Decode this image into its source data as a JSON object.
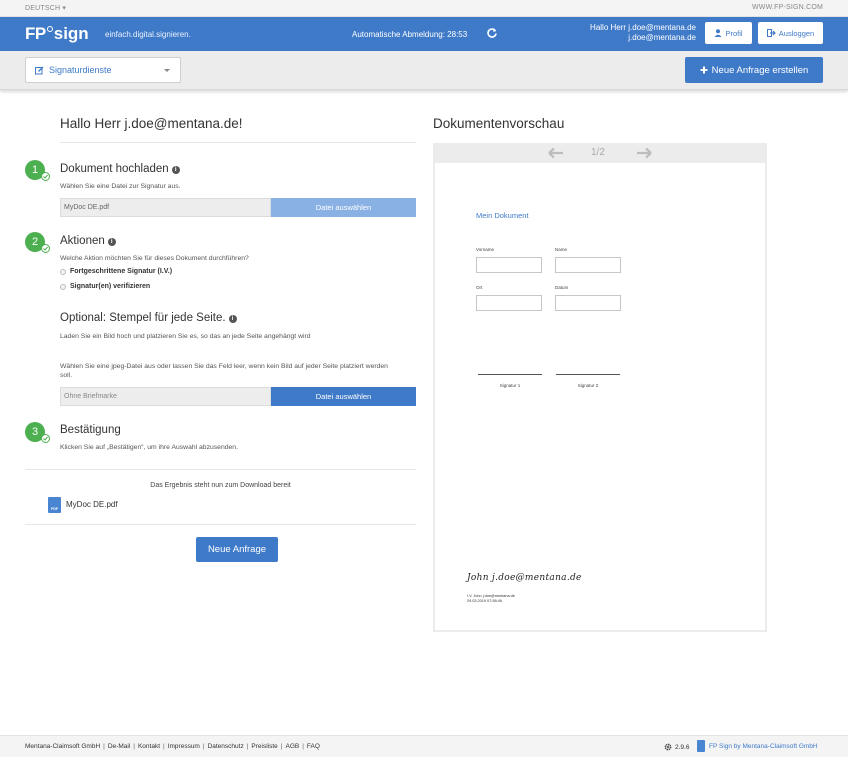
{
  "topbar": {
    "language": "DEUTSCH",
    "site": "WWW.FP-SIGN.COM"
  },
  "header": {
    "logo_fp": "FP",
    "logo_sign": "sign",
    "slogan": "einfach.digital.signieren.",
    "logout_timer": "Automatische Abmeldung: 28:53",
    "greeting_line1": "Hallo Herr j.doe@mentana.de",
    "greeting_line2": "j.doe@mentana.de",
    "profile_label": "Profil",
    "logout_label": "Ausloggen"
  },
  "subbar": {
    "dropdown_label": "Signaturdienste",
    "new_request_label": "Neue Anfrage erstellen"
  },
  "main": {
    "hello": "Hallo Herr j.doe@mentana.de!",
    "step1": {
      "number": "1",
      "title": "Dokument hochladen",
      "desc": "Wählen Sie eine Datei zur Signatur aus.",
      "file_value": "MyDoc DE.pdf",
      "file_button": "Datei auswählen"
    },
    "step2": {
      "number": "2",
      "title": "Aktionen",
      "desc": "Welche Aktion möchten Sie für dieses Dokument durchführen?",
      "options": [
        "Fortgeschrittene Signatur (I.V.)",
        "Signatur(en) verifizieren"
      ],
      "stamp_title": "Optional: Stempel für jede Seite.",
      "stamp_desc": "Laden Sie ein Bild hoch und platzieren Sie es, so das an jede Seite angehängt wird",
      "stamp_desc2": "Wählen Sie eine jpeg-Datei aus oder lassen Sie das Feld leer, wenn kein Bild auf jeder Seite platziert werden soll.",
      "stamp_placeholder": "Ohne Briefmarke",
      "stamp_button": "Datei auswählen"
    },
    "step3": {
      "number": "3",
      "title": "Bestätigung",
      "desc": "Klicken Sie auf „Bestätigen“, um ihre Auswahl abzusenden."
    },
    "result_text": "Das Ergebnis steht nun zum Download bereit",
    "result_file": "MyDoc DE.pdf",
    "pdf_icon_text": "PDF",
    "new_request_button": "Neue Anfrage"
  },
  "preview": {
    "title": "Dokumentenvorschau",
    "page_indicator": "1/2",
    "doc_title": "Mein Dokument",
    "labels": {
      "vorname": "Vorname",
      "name": "Name",
      "ort": "Ort",
      "datum": "Datum"
    },
    "sig1": "Signatur 1",
    "sig2": "Signatur 2",
    "handwriting": "John j.doe@mentana.de",
    "sig_meta_line1": "I.V. John j.doe@mentana.de",
    "sig_meta_line2": "29.03.2019 07:58:46"
  },
  "footer": {
    "links": [
      "Mentana-Claimsoft GmbH",
      "De-Mail",
      "Kontakt",
      "Impressum",
      "Datenschutz",
      "Preisliste",
      "AGB",
      "FAQ"
    ],
    "version": "2.9.6",
    "brand": "FP Sign by Mentana-Claimsoft GmbH"
  },
  "colors": {
    "primary": "#3f7ac8",
    "primary_light": "#8ab1e4",
    "success": "#4caf50"
  }
}
